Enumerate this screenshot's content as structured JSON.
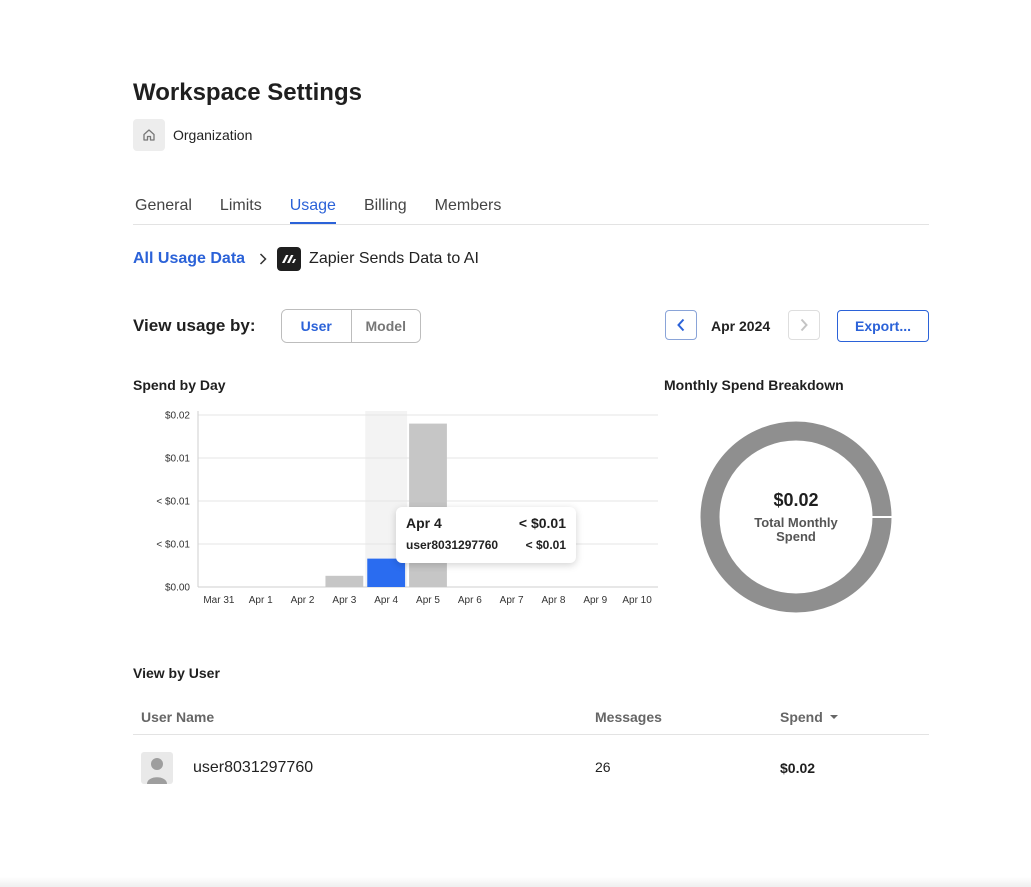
{
  "page": {
    "title": "Workspace Settings"
  },
  "org": {
    "name": "Organization"
  },
  "tabs": [
    {
      "label": "General"
    },
    {
      "label": "Limits"
    },
    {
      "label": "Usage"
    },
    {
      "label": "Billing"
    },
    {
      "label": "Members"
    }
  ],
  "active_tab": "Usage",
  "breadcrumb": {
    "parent": "All Usage Data",
    "current": "Zapier Sends Data to AI"
  },
  "view_by": {
    "label": "View usage by:",
    "options": [
      "User",
      "Model"
    ],
    "selected": "User"
  },
  "period": {
    "month": "Apr 2024"
  },
  "export": {
    "label": "Export..."
  },
  "sections": {
    "spend_by_day": "Spend by Day",
    "monthly_breakdown": "Monthly Spend Breakdown",
    "view_by_user": "View by User"
  },
  "chart_data": [
    {
      "type": "bar",
      "title": "Spend by Day",
      "categories": [
        "Mar 31",
        "Apr 1",
        "Apr 2",
        "Apr 3",
        "Apr 4",
        "Apr 5",
        "Apr 6",
        "Apr 7",
        "Apr 8",
        "Apr 9",
        "Apr 10"
      ],
      "values": [
        0,
        0,
        0,
        0.0013,
        0.0033,
        0.019,
        0,
        0,
        0,
        0,
        0
      ],
      "y_tick_labels": [
        "$0.00",
        "< $0.01",
        "< $0.01",
        "$0.01",
        "$0.02"
      ],
      "ylim": [
        0,
        0.02
      ],
      "grid": true,
      "highlighted_category": "Apr 4",
      "colors": {
        "bar": "#c6c6c6",
        "highlight": "#2a6cf0",
        "hover_band": "#f3f3f3"
      }
    },
    {
      "type": "pie",
      "title": "Monthly Spend Breakdown",
      "slices": [
        {
          "label": "user8031297760",
          "value": 0.02
        }
      ],
      "center_value": "$0.02",
      "center_label": "Total Monthly Spend",
      "colors": {
        "ring": "#8f8f8f"
      }
    }
  ],
  "tooltip": {
    "date": "Apr 4",
    "total": "< $0.01",
    "user": "user8031297760",
    "user_value": "< $0.01"
  },
  "table": {
    "columns": {
      "name": "User Name",
      "messages": "Messages",
      "spend": "Spend"
    },
    "rows": [
      {
        "name": "user8031297760",
        "messages": "26",
        "spend": "$0.02"
      }
    ]
  },
  "colors": {
    "accent": "#2b62d8"
  },
  "icons": {
    "org": "home-icon",
    "app": "zapier-logo-icon",
    "avatar": "user-avatar-icon",
    "sort": "caret-down-icon"
  }
}
